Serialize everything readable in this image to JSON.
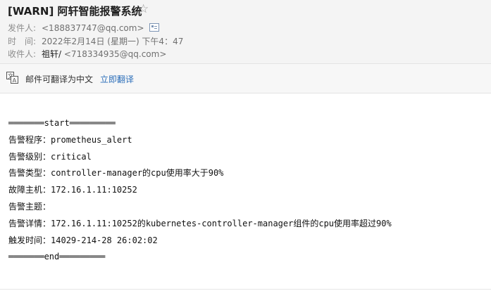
{
  "email": {
    "subject": "[WARN] 阿轩智能报警系统",
    "star_icon": "star-outline-icon",
    "sender_label": "发件人:",
    "sender_email": "<188837747@qq.com>",
    "time_label": "时　间:",
    "time_value": "2022年2月14日 (星期一) 下午4：47",
    "recipient_label": "收件人:",
    "recipient_name": "祖轩/",
    "recipient_email": "<718334935@qq.com>"
  },
  "translate_bar": {
    "icon": "translate-icon",
    "text": "邮件可翻译为中文",
    "link": "立即翻译"
  },
  "content": {
    "start_line": "═══════start═════════",
    "lines": [
      {
        "key": "告警程序：",
        "value": "prometheus_alert"
      },
      {
        "key": "告警级别：",
        "value": "critical"
      },
      {
        "key": "告警类型：",
        "value": "controller-manager的cpu使用率大于90%"
      },
      {
        "key": "故障主机：",
        "value": "172.16.1.11:10252"
      },
      {
        "key": "告警主题：",
        "value": ""
      },
      {
        "key": "告警详情：",
        "value": "172.16.1.11:10252的kubernetes-controller-manager组件的cpu使用率超过90%"
      },
      {
        "key": "触发时间：",
        "value": "14029-214-28 26:02:02"
      }
    ],
    "end_line": "═══════end═════════"
  }
}
